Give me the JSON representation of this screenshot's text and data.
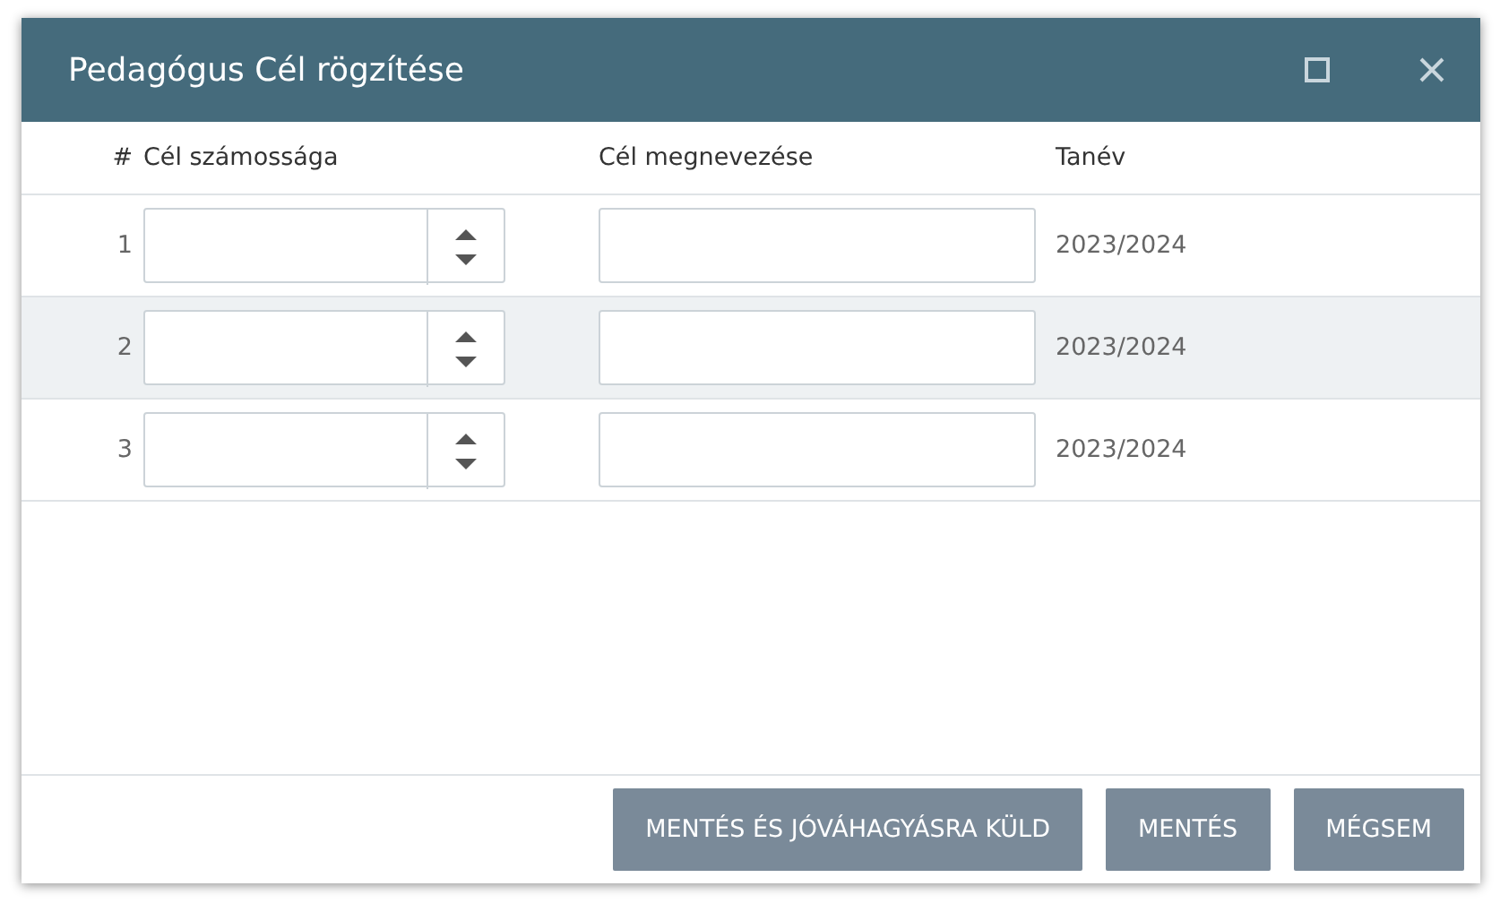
{
  "window": {
    "title": "Pedagógus Cél rögzítése"
  },
  "table": {
    "columns": [
      "#",
      "Cél számossága",
      "Cél megnevezése",
      "Tanév"
    ],
    "rows": [
      {
        "number": "1",
        "tanev": "2023/2024"
      },
      {
        "number": "2",
        "tanev": "2023/2024"
      },
      {
        "number": "3",
        "tanev": "2023/2024"
      }
    ]
  },
  "buttons": [
    "MENTÉS ÉS JÓVÁHAGYÁSRA KÜLD",
    "MENTÉS",
    "MÉGSEM"
  ]
}
